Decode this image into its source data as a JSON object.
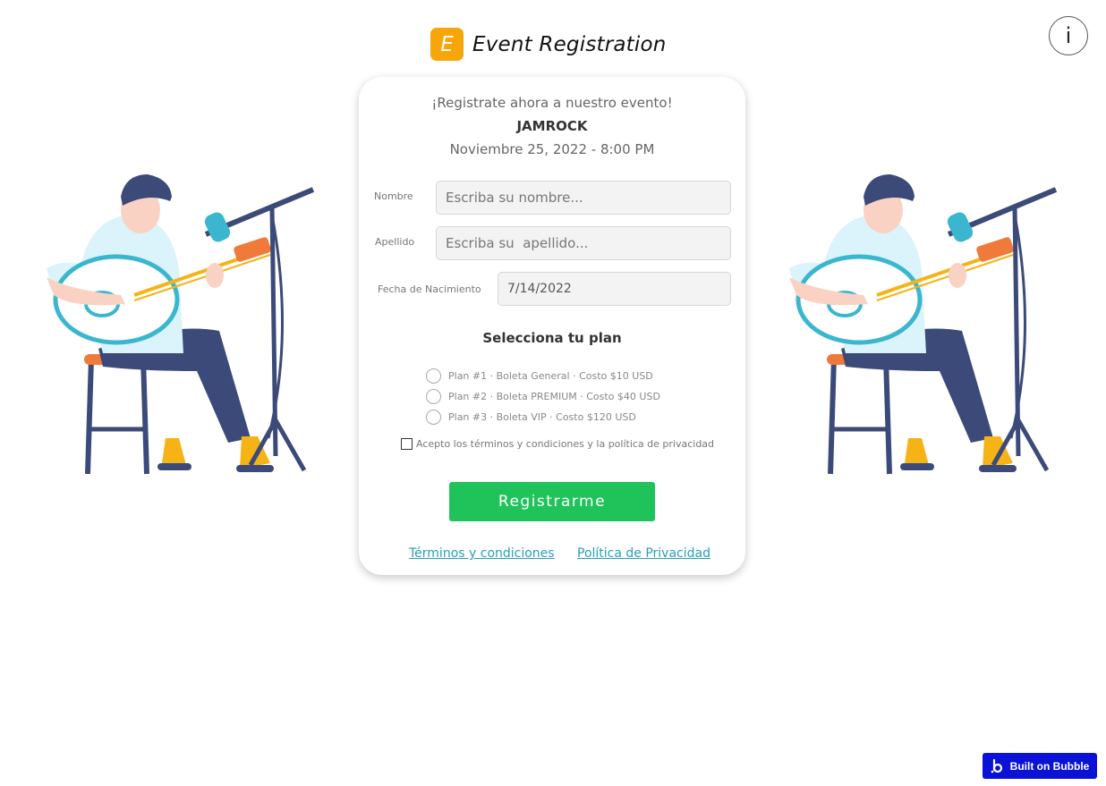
{
  "header": {
    "logo_letter": "E",
    "title": "Event Registration",
    "logo_color": "#f6a60a"
  },
  "info_button": {
    "label": "i",
    "icon": "info-icon"
  },
  "illustrations": {
    "icon": "guitarist-illustration"
  },
  "form": {
    "intro": "¡Registrate ahora a nuestro evento!",
    "event_name": "JAMROCK",
    "event_date": "Noviembre 25, 2022 - 8:00 PM",
    "fields": {
      "first_name": {
        "label": "Nombre",
        "placeholder": "Escriba su nombre...",
        "value": ""
      },
      "last_name": {
        "label": "Apellido",
        "placeholder": "Escriba su  apellido...",
        "value": ""
      },
      "birth_date": {
        "label": "Fecha de Nacimiento",
        "value": "7/14/2022"
      }
    },
    "plan_heading": "Selecciona tu plan",
    "plans": [
      {
        "label": "Plan #1 · Boleta General · Costo $10 USD"
      },
      {
        "label": "Plan #2 · Boleta PREMIUM · Costo $40 USD"
      },
      {
        "label": "Plan #3 · Boleta VIP · Costo $120 USD"
      }
    ],
    "terms_label": "Acepto los términos y condiciones y la política de privacidad",
    "submit_label": "Registrarme",
    "submit_color": "#20c35a",
    "links": {
      "terms": "Términos y condiciones",
      "privacy": "Política de Privacidad"
    }
  },
  "badge": {
    "label": "Built on Bubble",
    "color": "#0a12d6"
  }
}
